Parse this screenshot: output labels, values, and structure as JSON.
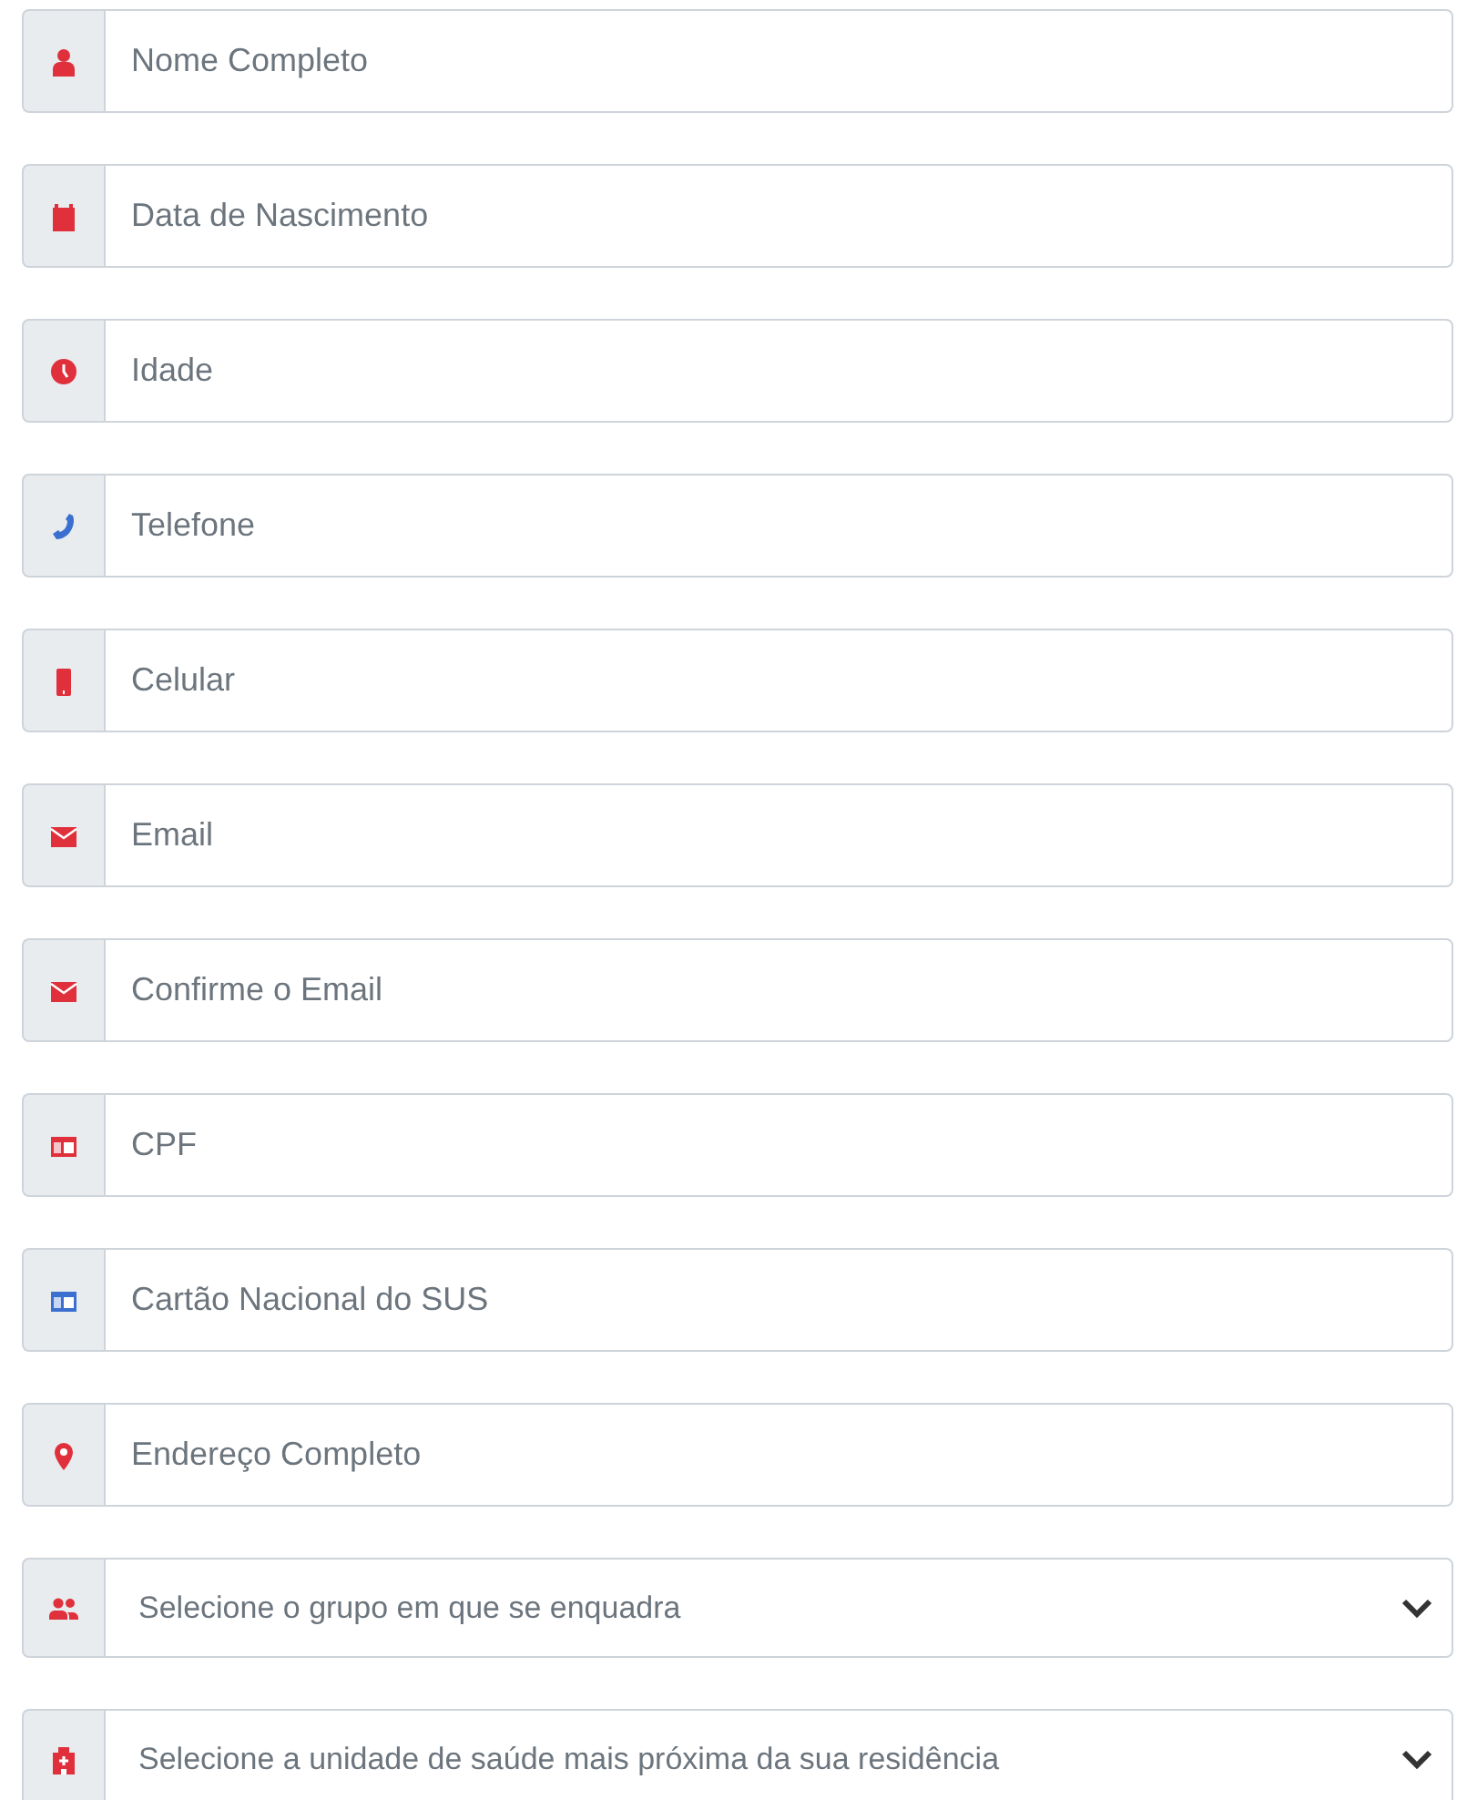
{
  "fields": [
    {
      "kind": "input",
      "placeholder": "Nome Completo"
    },
    {
      "kind": "input",
      "placeholder": "Data de Nascimento"
    },
    {
      "kind": "input",
      "placeholder": "Idade"
    },
    {
      "kind": "input",
      "placeholder": "Telefone"
    },
    {
      "kind": "input",
      "placeholder": "Celular"
    },
    {
      "kind": "input",
      "placeholder": "Email"
    },
    {
      "kind": "input",
      "placeholder": "Confirme o Email"
    },
    {
      "kind": "input",
      "placeholder": "CPF"
    },
    {
      "kind": "input",
      "placeholder": "Cartão Nacional do SUS"
    },
    {
      "kind": "input",
      "placeholder": "Endereço Completo"
    },
    {
      "kind": "select",
      "placeholder": "Selecione o grupo em que se enquadra"
    },
    {
      "kind": "select",
      "placeholder": "Selecione a unidade de saúde mais próxima da sua residência"
    }
  ]
}
